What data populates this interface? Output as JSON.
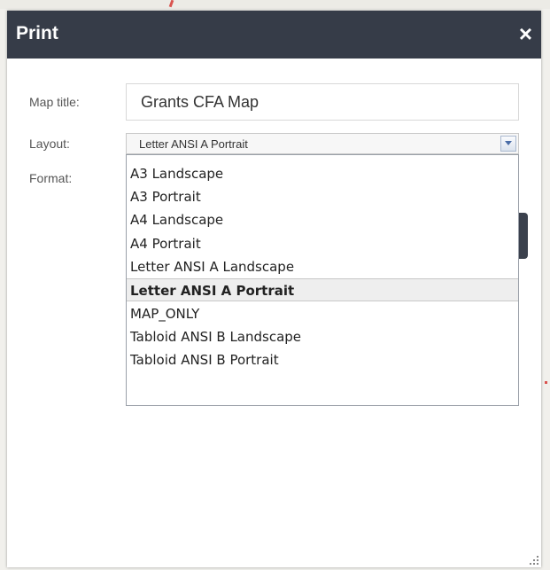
{
  "dialog": {
    "title": "Print",
    "close_icon": "×"
  },
  "form": {
    "map_title_label": "Map title:",
    "map_title_value": "Grants CFA Map",
    "layout_label": "Layout:",
    "layout_value": "Letter ANSI A Portrait",
    "format_label": "Format:"
  },
  "dropdown": {
    "options": [
      "A3 Landscape",
      "A3 Portrait",
      "A4 Landscape",
      "A4 Portrait",
      "Letter ANSI A Landscape",
      "Letter ANSI A Portrait",
      "MAP_ONLY",
      "Tabloid ANSI B Landscape",
      "Tabloid ANSI B Portrait"
    ],
    "selected": "Letter ANSI A Portrait"
  },
  "colors": {
    "titlebar": "#363c48",
    "accent_arrow": "#4a6da7"
  },
  "icons": {
    "close": "close-icon",
    "dropdown_arrow": "chevron-down-icon",
    "resize": "resize-grip-icon"
  }
}
